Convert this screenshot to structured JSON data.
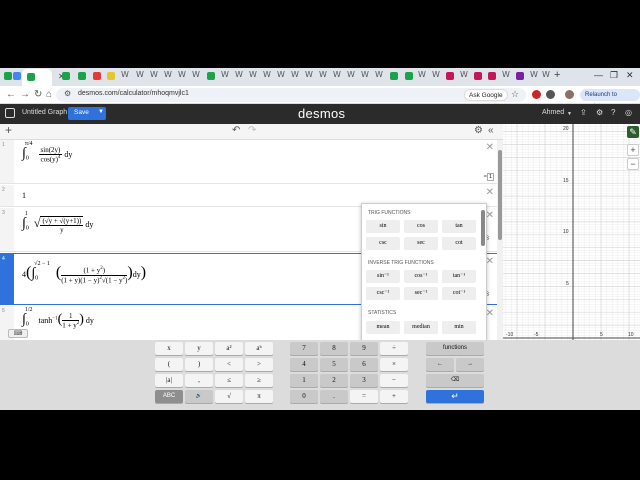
{
  "browser": {
    "tab_letter": "W",
    "url": "desmos.com/calculator/mhoqmvjlc1",
    "ask_google": "Ask Google",
    "relaunch": "Relaunch to update"
  },
  "desmos": {
    "title": "Untitled Graph",
    "save": "Save",
    "logo": "desmos",
    "user": "Ahmed"
  },
  "expressions": [
    {
      "index": "1",
      "text": "∫₀^(π/4) sin(2y) / cos(y)⁴ dy"
    },
    {
      "index": "2",
      "text": "1"
    },
    {
      "index": "3",
      "text": "∫₀¹ √((√y + √(y+1)) / y) dy"
    },
    {
      "index": "4",
      "text": "4(∫₀^(√2 − 1) ((1+y²) / ((1+y)(1−y)²√(1−y²))) dy)"
    },
    {
      "index": "5",
      "text": "∫₀^(1/2) tanh⁻¹(1 / (1+y²)) dy"
    }
  ],
  "expr1_result": "=",
  "expr1_badge": "1",
  "expr3_result": "3",
  "expr4_result": "3",
  "function_popup": {
    "sections": [
      {
        "title": "TRIG FUNCTIONS",
        "items": [
          "sin",
          "cos",
          "tan",
          "csc",
          "sec",
          "cot"
        ]
      },
      {
        "title": "INVERSE TRIG FUNCTIONS",
        "items": [
          "sin⁻¹",
          "cos⁻¹",
          "tan⁻¹",
          "csc⁻¹",
          "sec⁻¹",
          "cot⁻¹"
        ]
      },
      {
        "title": "STATISTICS",
        "items": [
          "mean",
          "median",
          "min"
        ]
      }
    ]
  },
  "graph": {
    "x_ticks": [
      "-10",
      "-5",
      "5",
      "10"
    ],
    "y_ticks": [
      "20",
      "15",
      "10",
      "5",
      "-5",
      "-10",
      "-15",
      "-20"
    ]
  },
  "keypad": {
    "left": [
      [
        "x",
        "y",
        "a²",
        "aᵇ"
      ],
      [
        "(",
        ")",
        "<",
        ">"
      ],
      [
        "|a|",
        ",",
        "≤",
        "≥"
      ],
      [
        "ABC",
        "🔊",
        "√",
        "π"
      ]
    ],
    "middle": [
      [
        "7",
        "8",
        "9",
        "÷"
      ],
      [
        "4",
        "5",
        "6",
        "×"
      ],
      [
        "1",
        "2",
        "3",
        "−"
      ],
      [
        "0",
        ".",
        "=",
        "+"
      ]
    ],
    "functions": "functions",
    "left_arrow": "←",
    "right_arrow": "→",
    "backspace": "⌫",
    "enter": "↵"
  }
}
